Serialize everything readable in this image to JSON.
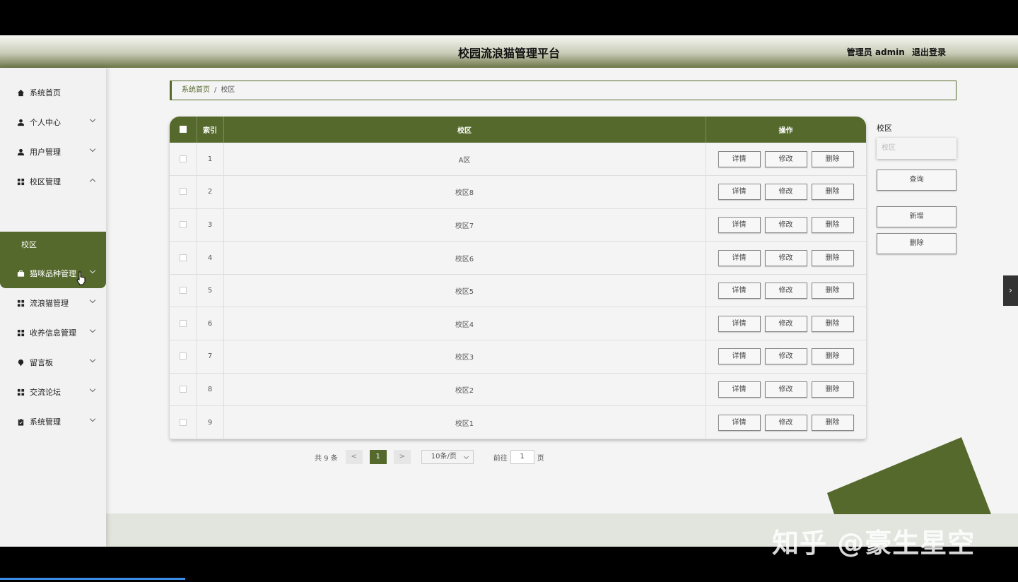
{
  "header": {
    "title": "校园流浪猫管理平台",
    "user_label": "管理员 admin",
    "logout_label": "退出登录"
  },
  "sidebar": {
    "items": [
      {
        "label": "系统首页",
        "icon": "home-icon"
      },
      {
        "label": "个人中心",
        "icon": "user-icon"
      },
      {
        "label": "用户管理",
        "icon": "user-icon"
      },
      {
        "label": "校区管理",
        "icon": "grid-icon"
      },
      {
        "label": "猫咪品种管理",
        "icon": "briefcase-icon"
      },
      {
        "label": "流浪猫管理",
        "icon": "grid-icon"
      },
      {
        "label": "收养信息管理",
        "icon": "grid-icon"
      },
      {
        "label": "留言板",
        "icon": "pin-icon"
      },
      {
        "label": "交流论坛",
        "icon": "grid-icon"
      },
      {
        "label": "系统管理",
        "icon": "clipboard-icon"
      }
    ],
    "submenu_label": "校区"
  },
  "breadcrumb": {
    "home": "系统首页",
    "separator": "/",
    "current": "校区"
  },
  "table": {
    "columns": [
      "索引",
      "校区",
      "操作"
    ],
    "rows": [
      {
        "index": "1",
        "name": "A区"
      },
      {
        "index": "2",
        "name": "校区8"
      },
      {
        "index": "3",
        "name": "校区7"
      },
      {
        "index": "4",
        "name": "校区6"
      },
      {
        "index": "5",
        "name": "校区5"
      },
      {
        "index": "6",
        "name": "校区4"
      },
      {
        "index": "7",
        "name": "校区3"
      },
      {
        "index": "8",
        "name": "校区2"
      },
      {
        "index": "9",
        "name": "校区1"
      }
    ],
    "actions": {
      "detail": "详情",
      "edit": "修改",
      "delete": "删除"
    }
  },
  "pagination": {
    "total": "共 9 条",
    "prev": "<",
    "current_page": "1",
    "next": ">",
    "page_size": "10条/页",
    "goto_label": "前往",
    "goto_value": "1",
    "page_suffix": "页"
  },
  "search": {
    "label": "校区",
    "placeholder": "校区",
    "query_label": "查询",
    "add_label": "新增",
    "delete_label": "删除"
  },
  "side_toggle": "›",
  "watermark": "知乎 @豪生星空",
  "colors": {
    "accent": "#55692c",
    "background": "#f4f4f4"
  }
}
